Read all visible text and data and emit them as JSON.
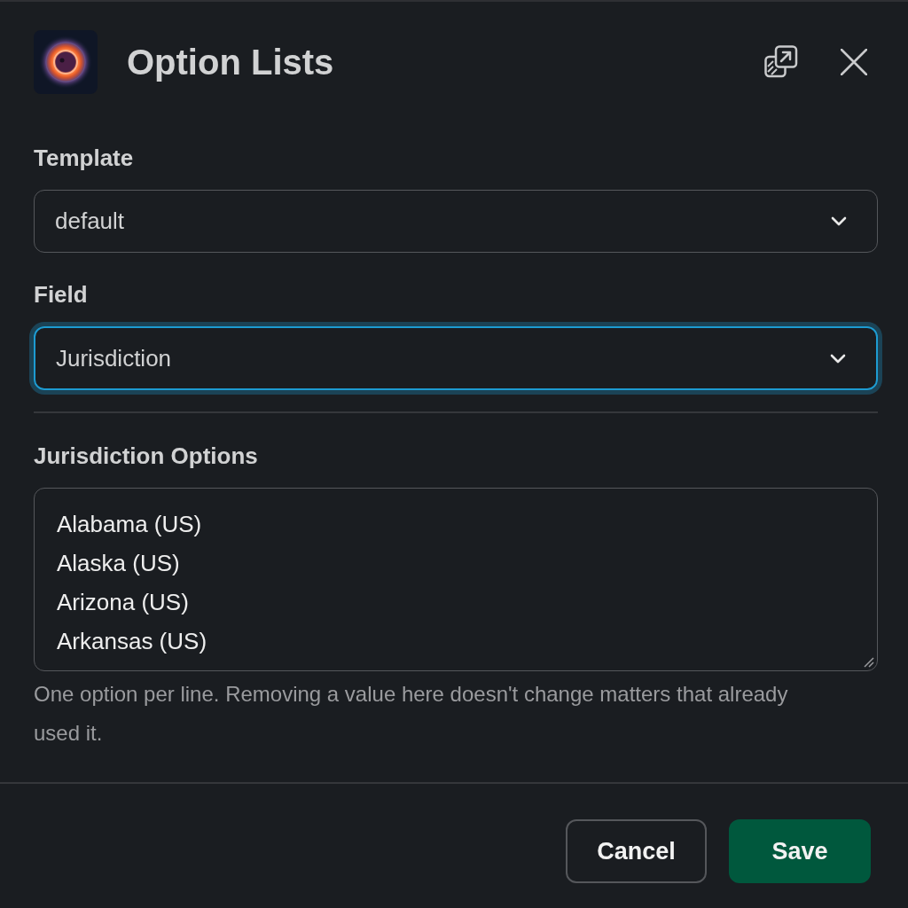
{
  "dialog": {
    "title": "Option Lists"
  },
  "selects": [
    {
      "label": "Template",
      "value": "default",
      "focused": false
    },
    {
      "label": "Field",
      "value": "Jurisdiction",
      "focused": true
    }
  ],
  "options_editor": {
    "label": "Jurisdiction Options",
    "lines": [
      "Alabama (US)",
      "Alaska (US)",
      "Arizona (US)",
      "Arkansas (US)"
    ],
    "help": "One option per line. Removing a value here doesn't change matters that already used it."
  },
  "buttons": [
    {
      "label": "Cancel",
      "kind": "secondary"
    },
    {
      "label": "Save",
      "kind": "primary"
    }
  ]
}
